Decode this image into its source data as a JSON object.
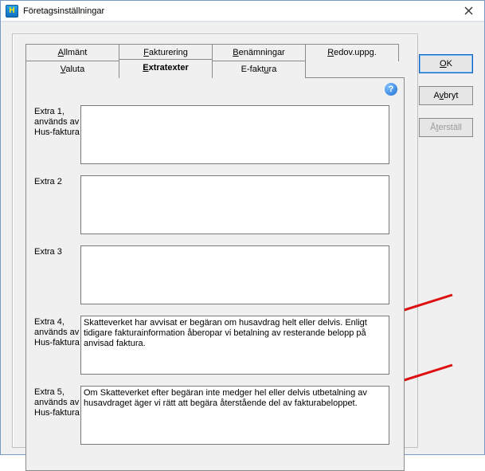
{
  "window": {
    "title": "Företagsinställningar"
  },
  "tabs": {
    "top": [
      {
        "pre": "",
        "u": "A",
        "post": "llmänt"
      },
      {
        "pre": "",
        "u": "F",
        "post": "akturering"
      },
      {
        "pre": "",
        "u": "B",
        "post": "enämningar"
      },
      {
        "pre": "",
        "u": "R",
        "post": "edov.uppg."
      }
    ],
    "second": [
      {
        "pre": "",
        "u": "V",
        "post": "aluta"
      },
      {
        "pre": "",
        "u": "E",
        "post": "xtratexter"
      },
      {
        "pre": "E-fakt",
        "u": "u",
        "post": "ra"
      }
    ],
    "active_second_index": 1
  },
  "fields": [
    {
      "label": "Extra 1, används av Hus-faktura",
      "value": ""
    },
    {
      "label": "Extra 2",
      "value": ""
    },
    {
      "label": "Extra 3",
      "value": ""
    },
    {
      "label": "Extra 4, används av Hus-faktura",
      "value": "Skatteverket har avvisat er begäran om husavdrag helt eller delvis. Enligt tidigare fakturainformation åberopar vi betalning av resterande belopp på anvisad faktura."
    },
    {
      "label": "Extra 5, används av Hus-faktura",
      "value": "Om Skatteverket efter begäran inte medger hel eller delvis utbetalning av husavdraget äger vi rätt att begära återstående del av fakturabeloppet."
    }
  ],
  "buttons": {
    "ok": {
      "pre": "",
      "u": "O",
      "post": "K"
    },
    "cancel": {
      "pre": "A",
      "u": "v",
      "post": "bryt"
    },
    "reset": {
      "pre": "Å",
      "u": "t",
      "post": "erställ"
    }
  },
  "help_glyph": "?"
}
